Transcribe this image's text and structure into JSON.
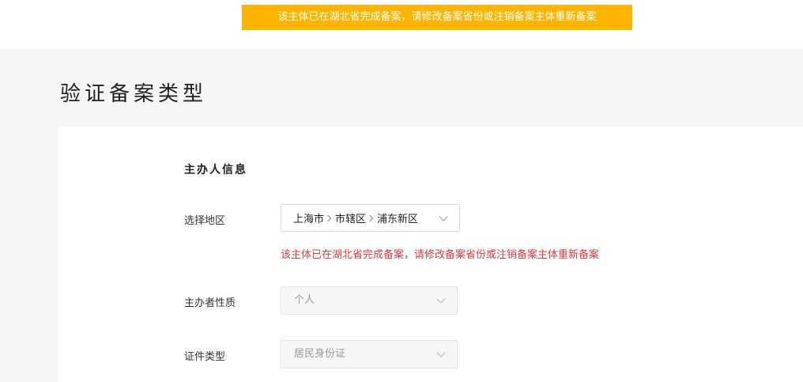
{
  "banner": {
    "message": "该主体已在湖北省完成备案，请修改备案省份或注销备案主体重新备案",
    "color": "#ffb400"
  },
  "page": {
    "title": "验证备案类型"
  },
  "form": {
    "section_title": "主办人信息",
    "region": {
      "label": "选择地区",
      "province": "上海市",
      "city": "市辖区",
      "district": "浦东新区",
      "icon": "chevron-down-icon",
      "separator_icon": "chevron-right-icon"
    },
    "error": {
      "message": "该主体已在湖北省完成备案，请修改备案省份或注销备案主体重新备案",
      "color": "#e4393c"
    },
    "organizer_type": {
      "label": "主办者性质",
      "value": "个人"
    },
    "id_type": {
      "label": "证件类型",
      "value": "居民身份证"
    }
  }
}
